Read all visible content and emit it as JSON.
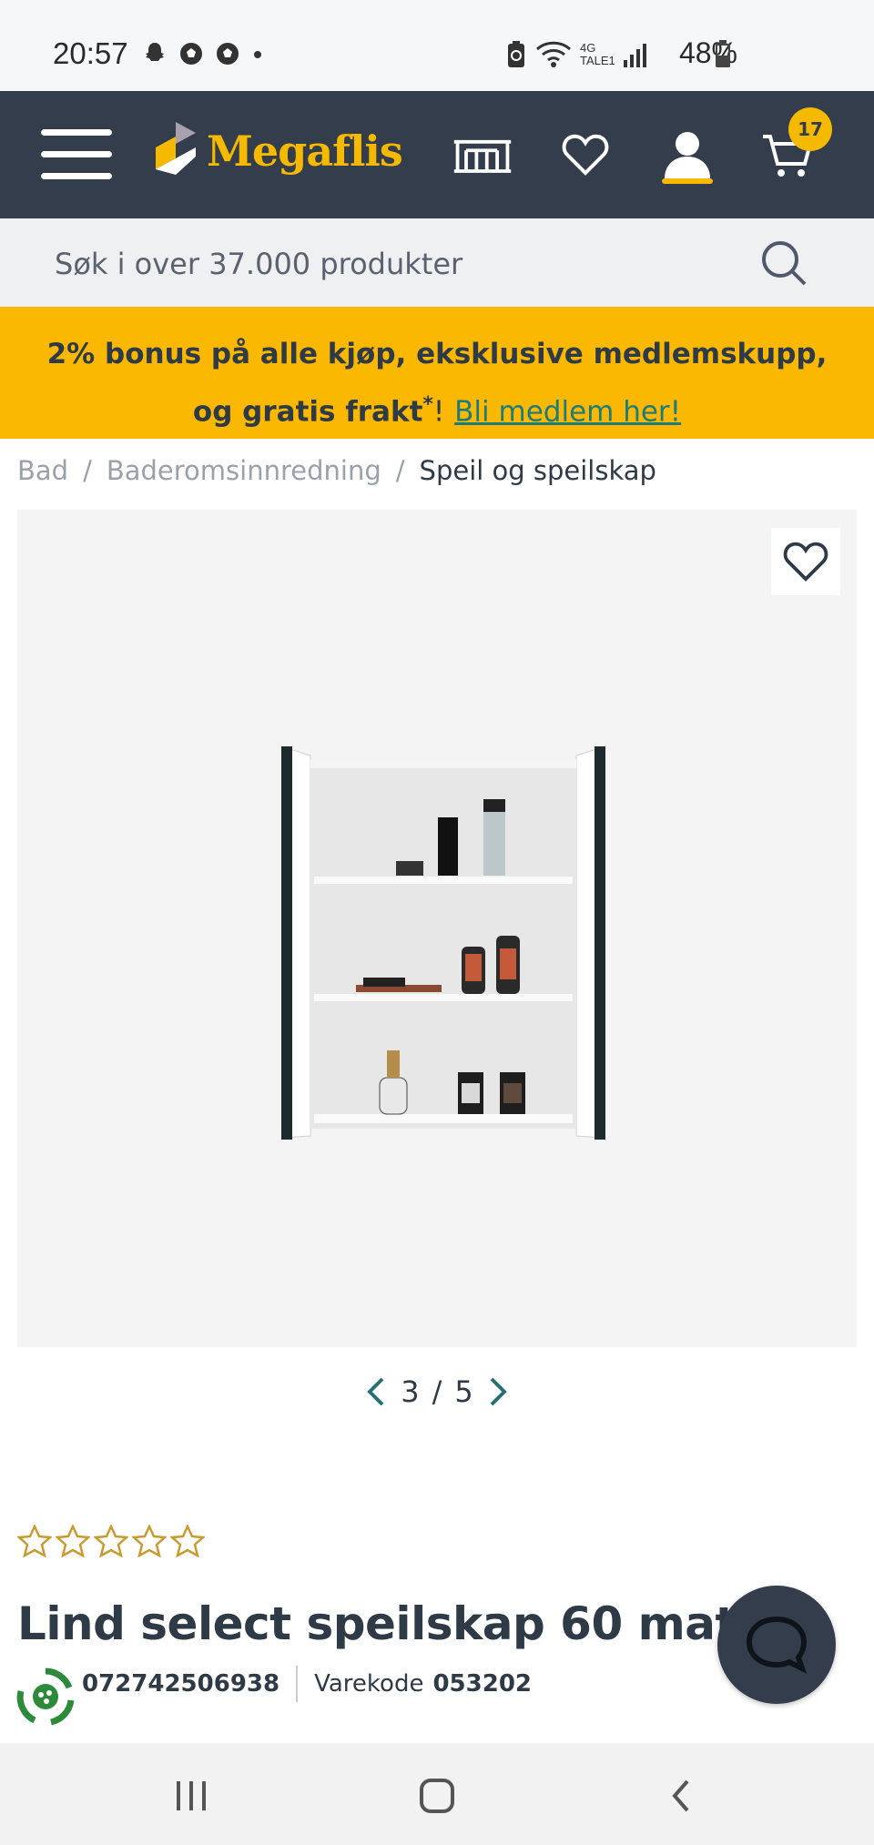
{
  "status_bar": {
    "time": "20:57",
    "network": "4G",
    "carrier_sub": "TALE1",
    "battery": "48%",
    "battery_level": 0.48
  },
  "header": {
    "logo_text": "Megaflis",
    "cart_count": "17",
    "brand_color": "#f5b900",
    "bg_color": "#333d4b"
  },
  "search": {
    "placeholder": "Søk i over 37.000 produkter"
  },
  "promo": {
    "line1": "2% bonus på alle kjøp, eksklusive medlemskupp,",
    "line2_prefix": "og gratis frakt",
    "line2_asterisk": "*",
    "line2_bang": "!",
    "link_text": "Bli medlem her!"
  },
  "breadcrumb": {
    "items": [
      "Bad",
      "Baderomsinnredning",
      "Speil og speilskap"
    ],
    "separator": "/"
  },
  "gallery": {
    "current": "3",
    "separator": "/",
    "total": "5"
  },
  "product": {
    "rating": 0,
    "rating_max": 5,
    "title": "Lind select speilskap 60 matt sort",
    "ean_fragment": "072742506938",
    "sku_label": "Varekode",
    "sku": "053202"
  }
}
